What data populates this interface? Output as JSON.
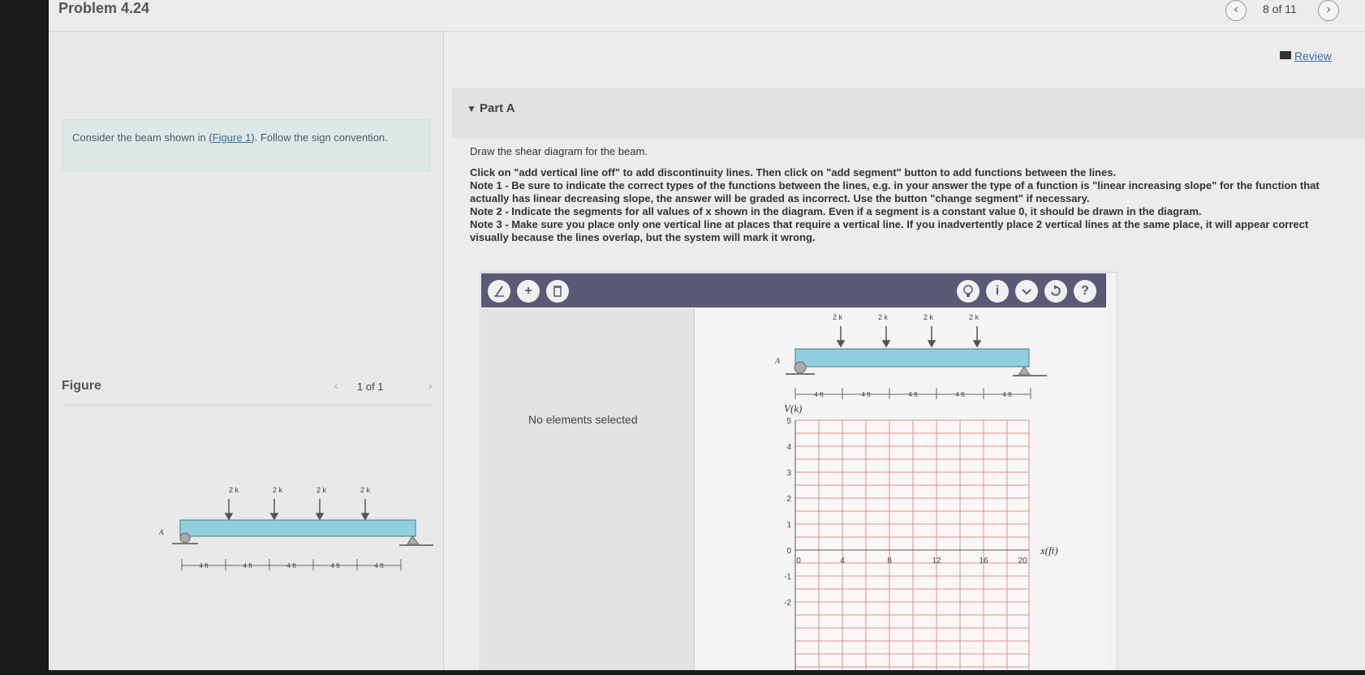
{
  "header": {
    "problem_title": "Problem 4.24",
    "prev_glyph": "‹",
    "next_glyph": "›",
    "page_counter": "8 of 11"
  },
  "left": {
    "intro_prefix": "Consider the beam shown in (",
    "intro_link": "Figure 1",
    "intro_suffix": "). Follow the sign convention.",
    "figure_label": "Figure",
    "figure_count": "1 of 1"
  },
  "review": {
    "label": "Review"
  },
  "part": {
    "title": "Part A",
    "lead": "Draw the shear diagram for the beam.",
    "line1": "Click on \"add vertical line off\" to add discontinuity lines. Then click on \"add segment\" button to add functions between the lines.",
    "line2": "Note 1 - Be sure to indicate the correct types of the functions between the lines, e.g. in your answer the type of a function is \"linear increasing slope\" for the function that actually has linear decreasing slope, the answer will be graded as incorrect. Use the button \"change segment\" if necessary.",
    "line3": "Note 2 - Indicate the segments for all values of x shown in the diagram. Even if a segment is a constant value 0, it should be drawn in the diagram.",
    "line4": "Note 3 - Make sure you place only one vertical line at places that require a vertical line. If you inadvertently place 2 vertical lines at the same place, it will appear correct visually because the lines overlap, but the system will mark it wrong."
  },
  "tool": {
    "no_elements": "No elements selected",
    "left_buttons": [
      "add-vertical-line",
      "add-segment",
      "delete"
    ],
    "right_buttons": [
      "hint",
      "info",
      "dropdown",
      "reset",
      "help"
    ],
    "help_glyph": "?",
    "info_glyph": "i",
    "plus_glyph": "+"
  },
  "beam": {
    "support_label": "A",
    "loads": [
      "2 k",
      "2 k",
      "2 k",
      "2 k"
    ],
    "span_labels": [
      "4 ft",
      "4 ft",
      "4 ft",
      "4 ft",
      "4 ft"
    ]
  },
  "graph": {
    "y_axis_label": "V(k)",
    "x_axis_label": "x(ft)",
    "y_ticks": [
      "5",
      "4",
      "3",
      "2",
      "1",
      "0",
      "-1",
      "-2"
    ],
    "x_ticks": [
      "0",
      "4",
      "8",
      "12",
      "16",
      "20"
    ]
  }
}
